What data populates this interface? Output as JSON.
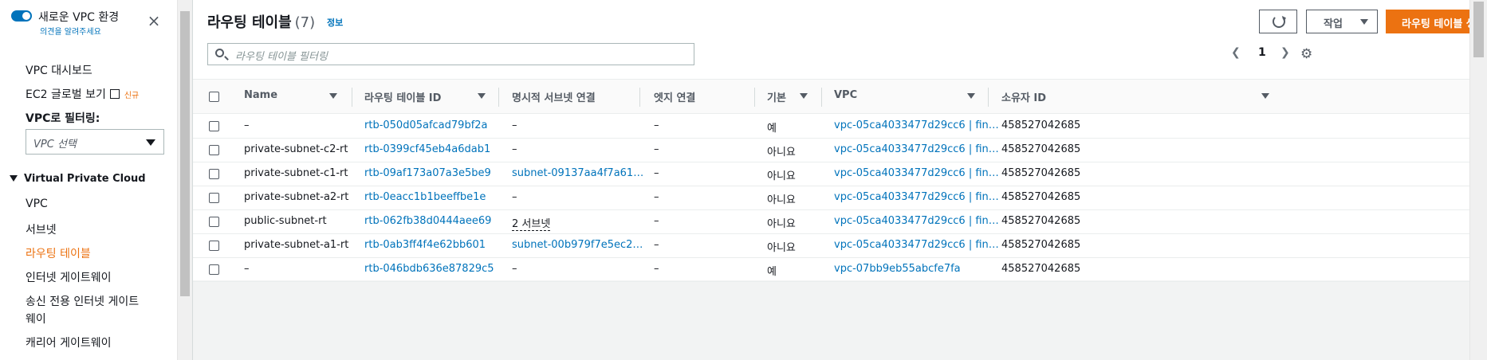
{
  "sidebar": {
    "new_vpc_label": "새로운 VPC 환경",
    "feedback": "의견을 알려주세요",
    "close_icon": "×",
    "dashboard": "VPC 대시보드",
    "ec2_global": "EC2 글로벌 보기",
    "new_badge": "신규",
    "filter_label": "VPC로 필터링:",
    "vpc_select_placeholder": "VPC 선택",
    "section_title": "Virtual Private Cloud",
    "items": [
      {
        "label": "VPC"
      },
      {
        "label": "서브넷"
      },
      {
        "label": "라우팅 테이블",
        "active": true
      },
      {
        "label": "인터넷 게이트웨이"
      },
      {
        "label": "송신 전용 인터넷 게이트"
      },
      {
        "label": "웨이"
      },
      {
        "label": "캐리어 게이트웨이"
      }
    ]
  },
  "header": {
    "title": "라우팅 테이블",
    "count": "(7)",
    "info": "정보",
    "action_button": "작업",
    "create_button": "라우팅 테이블 생성",
    "filter_placeholder": "라우팅 테이블 필터링",
    "page": "1"
  },
  "table": {
    "columns": [
      "Name",
      "라우팅 테이블 ID",
      "명시적 서브넷 연결",
      "엣지 연결",
      "기본",
      "VPC",
      "소유자 ID"
    ],
    "rows": [
      {
        "name": "–",
        "id": "rtb-050d05afcad79bf2a",
        "subnet": "–",
        "edge": "–",
        "main": "예",
        "vpc": "vpc-05ca4033477d29cc6 | fin…",
        "owner": "458527042685"
      },
      {
        "name": "private-subnet-c2-rt",
        "id": "rtb-0399cf45eb4a6dab1",
        "subnet": "–",
        "edge": "–",
        "main": "아니요",
        "vpc": "vpc-05ca4033477d29cc6 | fin…",
        "owner": "458527042685"
      },
      {
        "name": "private-subnet-c1-rt",
        "id": "rtb-09af173a07a3e5be9",
        "subnet": "subnet-09137aa4f7a61…",
        "edge": "–",
        "main": "아니요",
        "vpc": "vpc-05ca4033477d29cc6 | fin…",
        "owner": "458527042685"
      },
      {
        "name": "private-subnet-a2-rt",
        "id": "rtb-0eacc1b1beeffbe1e",
        "subnet": "–",
        "edge": "–",
        "main": "아니요",
        "vpc": "vpc-05ca4033477d29cc6 | fin…",
        "owner": "458527042685"
      },
      {
        "name": "public-subnet-rt",
        "id": "rtb-062fb38d0444aee69",
        "subnet": "2 서브넷",
        "edge": "–",
        "main": "아니요",
        "vpc": "vpc-05ca4033477d29cc6 | fin…",
        "owner": "458527042685"
      },
      {
        "name": "private-subnet-a1-rt",
        "id": "rtb-0ab3ff4f4e62bb601",
        "subnet": "subnet-00b979f7e5ec2…",
        "edge": "–",
        "main": "아니요",
        "vpc": "vpc-05ca4033477d29cc6 | fin…",
        "owner": "458527042685"
      },
      {
        "name": "–",
        "id": "rtb-046bdb636e87829c5",
        "subnet": "–",
        "edge": "–",
        "main": "예",
        "vpc": "vpc-07bb9eb55abcfe7fa",
        "owner": "458527042685"
      }
    ]
  },
  "colors": {
    "accent": "#ec7211",
    "link": "#0073bb"
  }
}
